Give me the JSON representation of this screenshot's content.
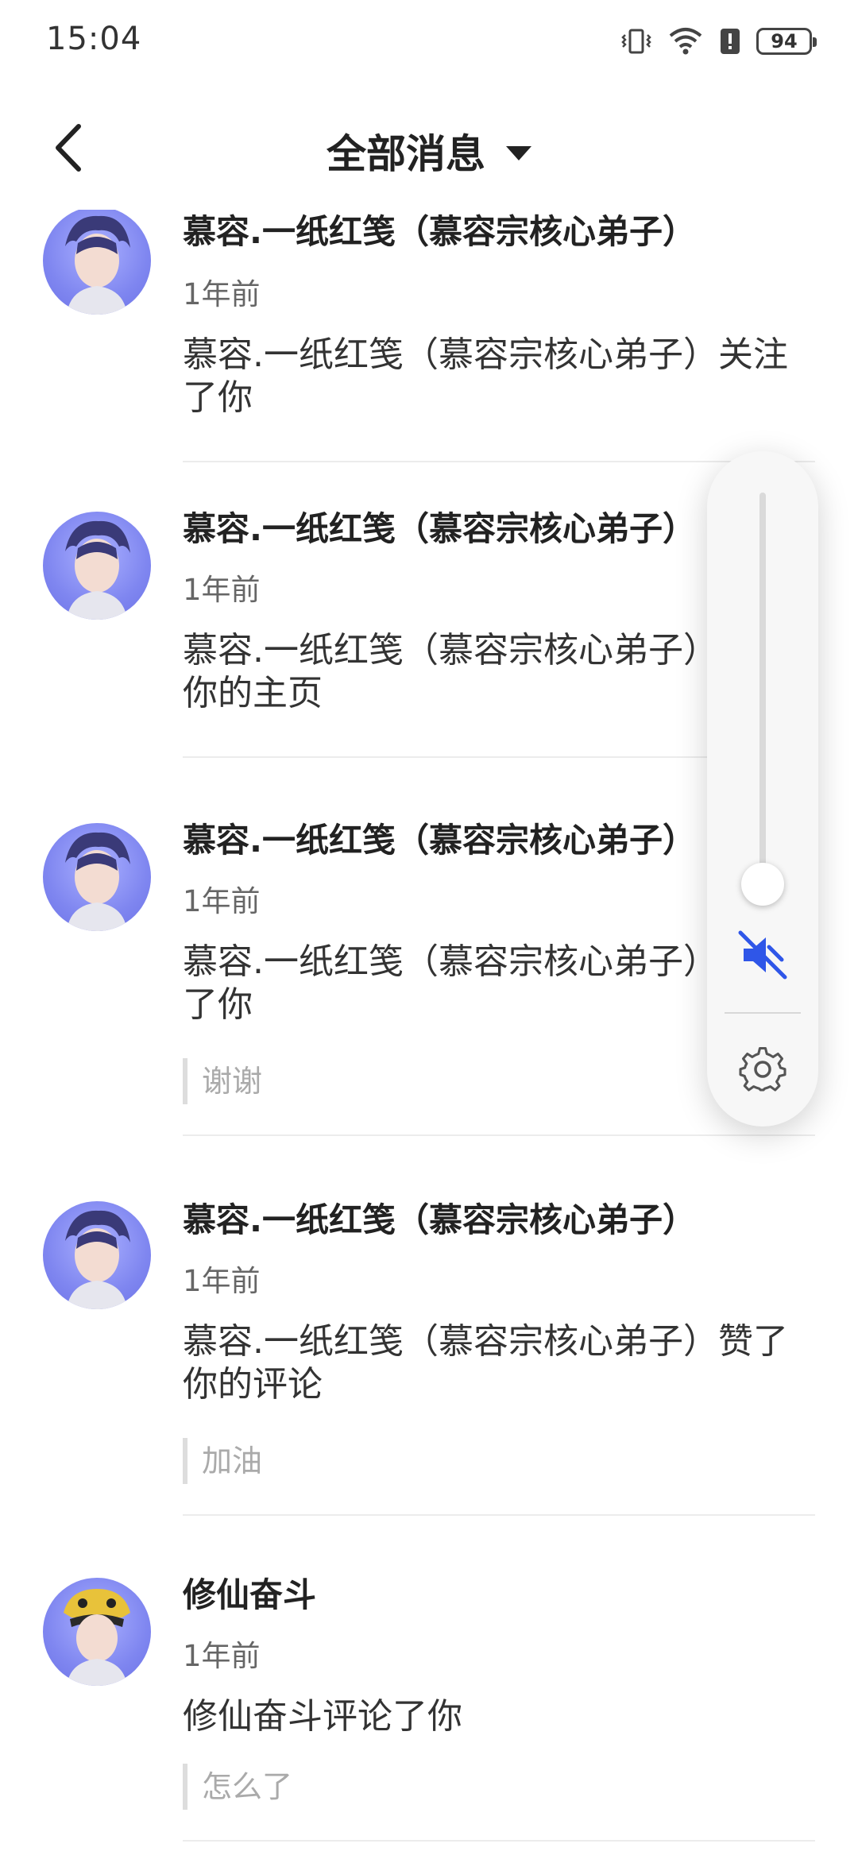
{
  "status_bar": {
    "time": "15:04",
    "battery": "94",
    "icons": [
      "vibrate-icon",
      "wifi-icon",
      "alert-icon",
      "battery-icon"
    ]
  },
  "header": {
    "title": "全部消息"
  },
  "notifications": [
    {
      "name": "慕容.一纸红笺（慕容宗核心弟子）",
      "time": "1年前",
      "message": "慕容.一纸红笺（慕容宗核心弟子）关注了你",
      "quote": ""
    },
    {
      "name": "慕容.一纸红笺（慕容宗核心弟子）",
      "time": "1年前",
      "message": "慕容.一纸红笺（慕容宗核心弟子）赞了你的主页",
      "quote": ""
    },
    {
      "name": "慕容.一纸红笺（慕容宗核心弟子）",
      "time": "1年前",
      "message": "慕容.一纸红笺（慕容宗核心弟子）回复了你",
      "quote": "谢谢"
    },
    {
      "name": "慕容.一纸红笺（慕容宗核心弟子）",
      "time": "1年前",
      "message": "慕容.一纸红笺（慕容宗核心弟子）赞了你的评论",
      "quote": "加油"
    },
    {
      "name": "修仙奋斗",
      "time": "1年前",
      "message": "修仙奋斗评论了你",
      "quote": "怎么了"
    }
  ],
  "volume_panel": {
    "level": 0,
    "muted": true,
    "accent_color": "#2f56e8"
  }
}
